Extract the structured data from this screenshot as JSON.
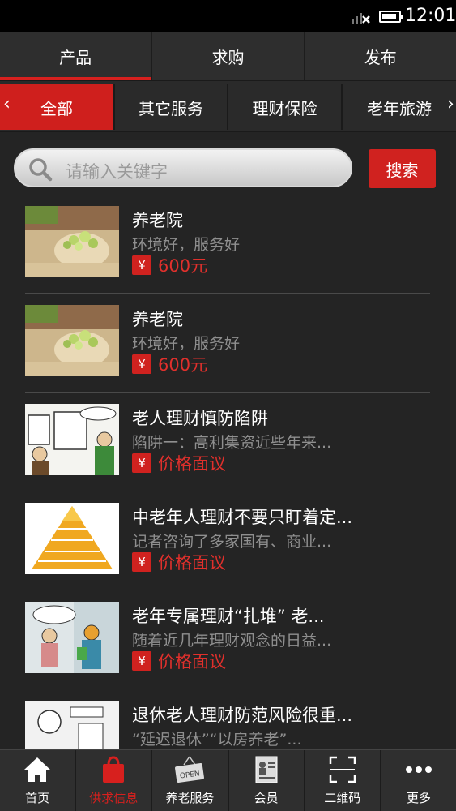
{
  "status": {
    "time": "12:01"
  },
  "top_tabs": [
    {
      "label": "产品",
      "active": true
    },
    {
      "label": "求购",
      "active": false
    },
    {
      "label": "发布",
      "active": false
    }
  ],
  "categories": {
    "left_arrow": "‹",
    "right_arrow": "›",
    "items": [
      {
        "label": "全部",
        "active": true
      },
      {
        "label": "其它服务",
        "active": false
      },
      {
        "label": "理财保险",
        "active": false
      },
      {
        "label": "老年旅游",
        "active": false
      }
    ]
  },
  "search": {
    "placeholder": "请输入关键字",
    "button": "搜索"
  },
  "list": [
    {
      "title": "养老院",
      "desc": "环境好，服务好",
      "price": "600元",
      "currency_icon": "¥",
      "thumb": "nursing-home-flowers"
    },
    {
      "title": "养老院",
      "desc": "环境好，服务好",
      "price": "600元",
      "currency_icon": "¥",
      "thumb": "nursing-home-flowers"
    },
    {
      "title": "老人理财慎防陷阱",
      "desc": "陷阱一：高利集资近些年来...",
      "price": "价格面议",
      "currency_icon": "¥",
      "thumb": "cartoon-elderly-scam"
    },
    {
      "title": "中老年人理财不要只盯着定...",
      "desc": "记者咨询了多家国有、商业...",
      "price": "价格面议",
      "currency_icon": "¥",
      "thumb": "gold-pyramid"
    },
    {
      "title": "老年专属理财“扎堆” 老...",
      "desc": "随着近几年理财观念的日益...",
      "price": "价格面议",
      "currency_icon": "¥",
      "thumb": "cartoon-elderly-finance"
    },
    {
      "title": "退休老人理财防范风险很重...",
      "desc": "“延迟退休”“以房养老”...",
      "price": "",
      "currency_icon": "¥",
      "thumb": "cartoon-retiree"
    }
  ],
  "bottom_nav": [
    {
      "label": "首页",
      "icon": "home-icon",
      "active": false
    },
    {
      "label": "供求信息",
      "icon": "shopping-bag-icon",
      "active": true
    },
    {
      "label": "养老服务",
      "icon": "open-sign-icon",
      "active": false
    },
    {
      "label": "会员",
      "icon": "member-card-icon",
      "active": false
    },
    {
      "label": "二维码",
      "icon": "qr-scan-icon",
      "active": false
    },
    {
      "label": "更多",
      "icon": "more-dots-icon",
      "active": false
    }
  ],
  "colors": {
    "accent": "#d0221f",
    "background": "#242424",
    "muted_text": "#8f8f8f"
  }
}
